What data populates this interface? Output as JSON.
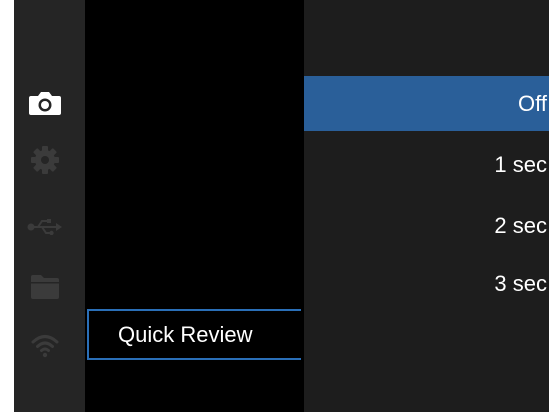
{
  "sidebar": {
    "icons": [
      {
        "name": "camera-icon",
        "active": true
      },
      {
        "name": "gear-icon",
        "active": false
      },
      {
        "name": "usb-icon",
        "active": false
      },
      {
        "name": "folder-icon",
        "active": false
      },
      {
        "name": "wifi-icon",
        "active": false
      }
    ]
  },
  "menu": {
    "selected_item_label": "Quick Review"
  },
  "options": {
    "items": [
      {
        "label": "Off",
        "selected": true
      },
      {
        "label": "1 sec",
        "selected": false
      },
      {
        "label": "2 sec",
        "selected": false
      },
      {
        "label": "3 sec",
        "selected": false
      }
    ]
  },
  "colors": {
    "background": "#000000",
    "sidebar": "#252525",
    "options_panel": "#1d1d1d",
    "selection": "#2a5f99",
    "menu_border": "#2a6fb8",
    "icon_active": "#ffffff",
    "icon_inactive": "#3b3b3b"
  }
}
